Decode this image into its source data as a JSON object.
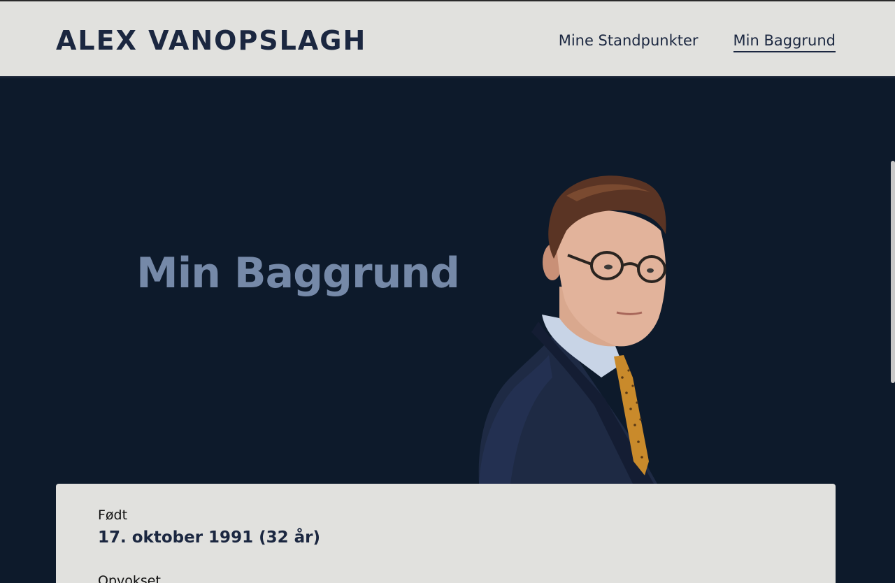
{
  "site": {
    "logo": "ALEX VANOPSLAGH"
  },
  "nav": {
    "items": [
      {
        "label": "Mine Standpunkter",
        "active": false
      },
      {
        "label": "Min Baggrund",
        "active": true
      }
    ]
  },
  "hero": {
    "title": "Min Baggrund",
    "portrait_icon": "portrait-photo"
  },
  "details": [
    {
      "label": "Født",
      "value": "17. oktober 1991 (32 år)"
    },
    {
      "label": "Opvokset",
      "value": ""
    }
  ],
  "colors": {
    "navy": "#0d1a2b",
    "light_panel": "#e1e1de",
    "title_blue": "#7589a8",
    "text_dark": "#1b2740",
    "tie_gold": "#c98a2b"
  }
}
